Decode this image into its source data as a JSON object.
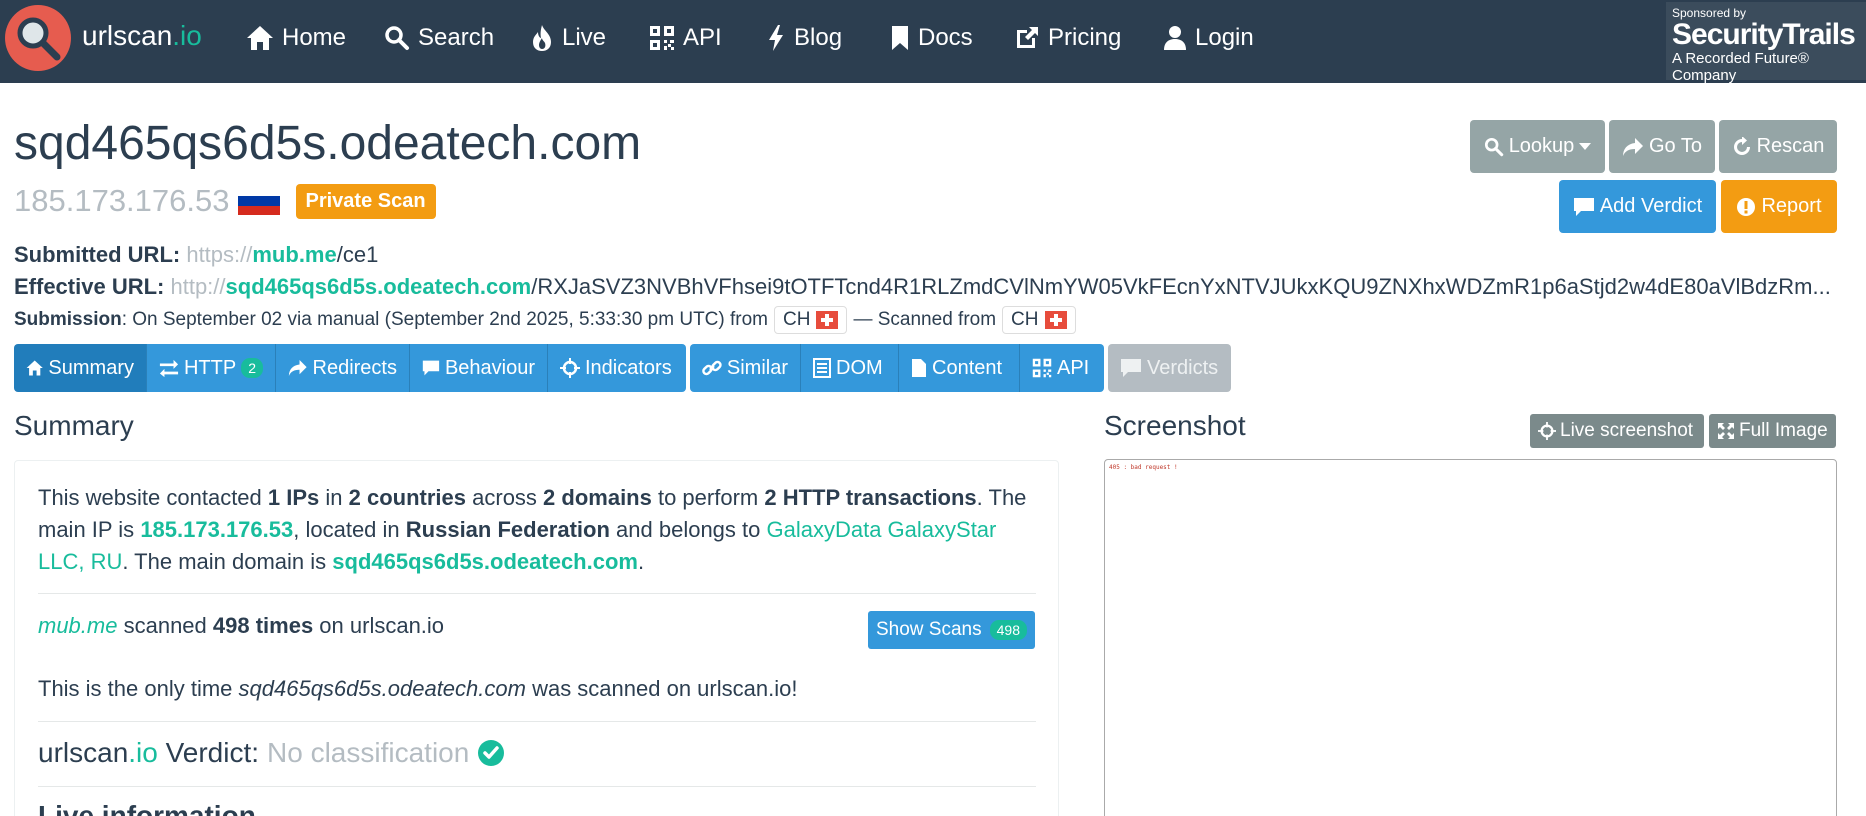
{
  "nav": {
    "brand_main": "urlscan",
    "brand_tld": ".io",
    "items": [
      {
        "label": "Home",
        "icon": "home-icon"
      },
      {
        "label": "Search",
        "icon": "search-icon"
      },
      {
        "label": "Live",
        "icon": "fire-icon"
      },
      {
        "label": "API",
        "icon": "qrcode-icon"
      },
      {
        "label": "Blog",
        "icon": "bolt-icon"
      },
      {
        "label": "Docs",
        "icon": "bookmark-icon"
      },
      {
        "label": "Pricing",
        "icon": "external-link-icon"
      },
      {
        "label": "Login",
        "icon": "user-icon"
      }
    ],
    "sponsor": {
      "line1": "Sponsored by",
      "line2": "SecurityTrails",
      "line3": "A Recorded Future® Company"
    }
  },
  "header": {
    "domain": "sqd465qs6d5s.odeatech.com",
    "ip": "185.173.176.53",
    "badge": "Private Scan",
    "buttons": {
      "lookup": "Lookup",
      "goto": "Go To",
      "rescan": "Rescan",
      "verdict": "Add Verdict",
      "report": "Report"
    }
  },
  "info": {
    "submitted_label": "Submitted URL:",
    "submitted_scheme": "https://",
    "submitted_host": "mub.me",
    "submitted_path": "/ce1",
    "effective_label": "Effective URL:",
    "effective_scheme": "http://",
    "effective_host": "sqd465qs6d5s.odeatech.com",
    "effective_path": "/RXJaSVZ3NVBhVFhsei9tOTFTcnd4R1RLZmdCVlNmYW05VkFEcnYxNTVJUkxKQU9ZNXhxWDZmR1p6aStjd2w4dE80aVlBdzRm...",
    "submission_label": "Submission",
    "submission_text": ": On September 02 via manual (September 2nd 2025, 5:33:30 pm UTC) from",
    "from_country": "CH",
    "scanned_text": "— Scanned from",
    "scanned_country": "CH"
  },
  "tabs": [
    {
      "label": "Summary",
      "icon": "home-icon"
    },
    {
      "label": "HTTP",
      "icon": "exchange-icon",
      "count": "2"
    },
    {
      "label": "Redirects",
      "icon": "share-icon"
    },
    {
      "label": "Behaviour",
      "icon": "comment-icon"
    },
    {
      "label": "Indicators",
      "icon": "crosshairs-icon"
    },
    {
      "label": "Similar",
      "icon": "link-icon"
    },
    {
      "label": "DOM",
      "icon": "list-icon"
    },
    {
      "label": "Content",
      "icon": "file-icon"
    },
    {
      "label": "API",
      "icon": "qrcode-icon"
    },
    {
      "label": "Verdicts",
      "icon": "comment-icon"
    }
  ],
  "summary": {
    "heading": "Summary",
    "p1_a": "This website contacted ",
    "p1_ips": "1 IPs",
    "p1_b": " in ",
    "p1_countries": "2 countries",
    "p1_c": " across ",
    "p1_domains": "2 domains",
    "p1_d": " to perform ",
    "p1_http": "2 HTTP transactions",
    "p1_e": ". The main IP is ",
    "p1_ip": "185.173.176.53",
    "p1_f": ", located in ",
    "p1_country": "Russian Federation",
    "p1_g": " and belongs to ",
    "p1_asn": "GalaxyData GalaxyStar LLC, RU",
    "p1_h": ". The main domain is ",
    "p1_domain": "sqd465qs6d5s.odeatech.com",
    "p1_i": ".",
    "scan_domain": "mub.me",
    "scan_a": " scanned ",
    "scan_times": "498 times",
    "scan_b": " on urlscan.io",
    "show_scans": "Show Scans",
    "show_scans_count": "498",
    "only_a": "This is the only time ",
    "only_domain": "sqd465qs6d5s.odeatech.com",
    "only_b": " was scanned on urlscan.io!",
    "verdict_brand": "urlscan",
    "verdict_tld": ".io",
    "verdict_label": " Verdict:",
    "verdict_value": "No classification",
    "live_heading": "Live information"
  },
  "screenshot": {
    "heading": "Screenshot",
    "live_btn": "Live screenshot",
    "full_btn": "Full Image",
    "content": "405 : bad request !"
  },
  "colors": {
    "navbar": "#2c3e50",
    "accent": "#18bc9c",
    "primary": "#3498db",
    "warning": "#f39c12",
    "muted": "#b4bcc2"
  }
}
